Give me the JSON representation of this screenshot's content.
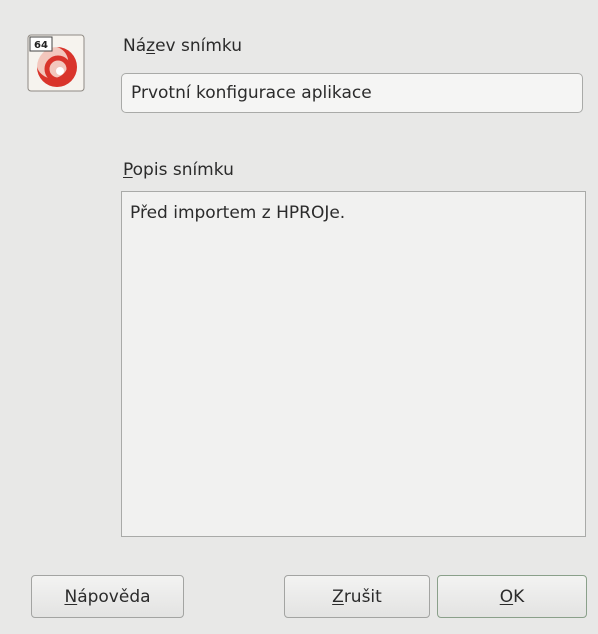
{
  "dialog": {
    "app_icon": "libreoffice-64-icon",
    "name_label": {
      "pre": "Ná",
      "key": "z",
      "post": "ev snímku"
    },
    "name_value": "Prvotní konfigurace aplikace",
    "desc_label": {
      "pre": "",
      "key": "P",
      "post": "opis snímku"
    },
    "desc_value": "Před importem z HPROJe."
  },
  "buttons": {
    "help": {
      "pre": "",
      "key": "N",
      "post": "ápověda"
    },
    "cancel": {
      "pre": "",
      "key": "Z",
      "post": "rušit"
    },
    "ok": {
      "pre": "",
      "key": "O",
      "post": "K"
    }
  },
  "colors": {
    "icon_red": "#d9342b",
    "icon_badge": "#ffffff",
    "background": "#e8e8e7"
  }
}
